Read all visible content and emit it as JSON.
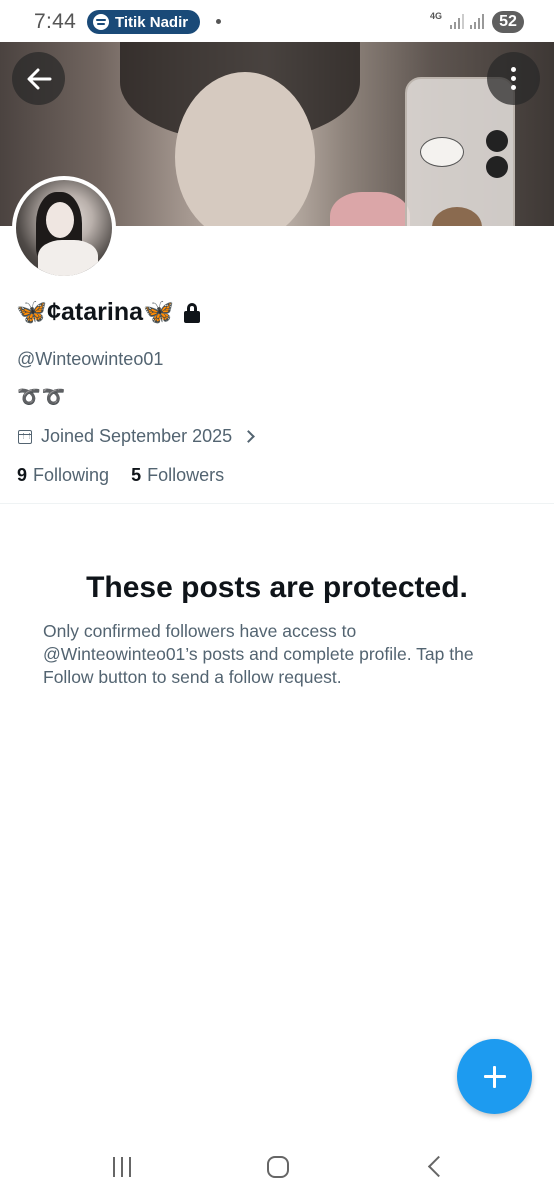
{
  "status_bar": {
    "time": "7:44",
    "spotify_label": "Titik Nadir",
    "network": "4G",
    "battery": "52"
  },
  "profile": {
    "display_name": "🦋¢atarina🦋",
    "handle": "@Winteowinteo01",
    "bio": "➰➰",
    "joined": "Joined September 2025",
    "following_count": "9",
    "following_label": "Following",
    "followers_count": "5",
    "followers_label": "Followers",
    "protected": true
  },
  "notice": {
    "title": "These posts are protected.",
    "body": "Only confirmed followers have access to @Winteowinteo01’s posts and complete profile. Tap the Follow button to send a follow request."
  },
  "colors": {
    "accent": "#1d9bf0",
    "text_primary": "#0f1419",
    "text_secondary": "#536471"
  },
  "icons": {
    "back": "arrow-left-icon",
    "more": "more-vertical-icon",
    "lock": "lock-icon",
    "calendar": "calendar-icon",
    "fab": "plus-icon"
  }
}
